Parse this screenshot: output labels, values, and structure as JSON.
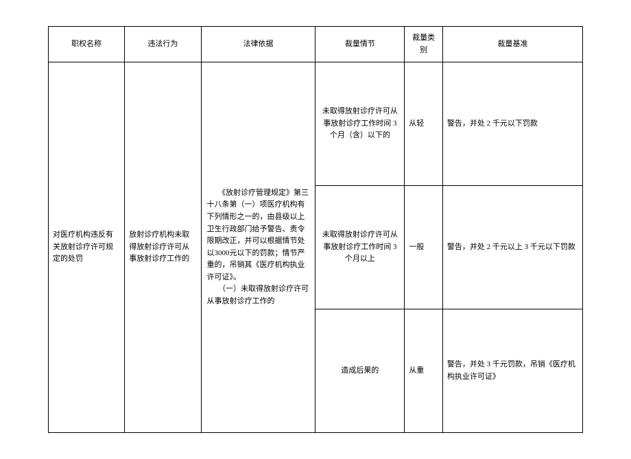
{
  "headers": {
    "authority": "职权名称",
    "violation": "违法行为",
    "legal_basis": "法律依据",
    "circumstance": "裁量情节",
    "category": "裁量类别",
    "standard": "裁量基准"
  },
  "content": {
    "authority_name": "对医疗机构违反有关放射诊疗许可规定的处罚",
    "violation_act": "放射诊疗机构未取得放射诊疗许可从事放射诊疗工作的",
    "legal_basis_text": "　　《放射诊疗管理规定》第三十八条第（一）项医疗机构有下列情形之一的，由县级以上卫生行政部门给予警告、责令限期改正，并可以根据情节处以3000元以下的罚款；情节严重的，吊销其《医疗机构执业许可证》。\n　　（一）未取得放射诊疗许可从事放射诊疗工作的",
    "rows": [
      {
        "circumstance": "未取得放射诊疗许可从事放射诊疗工作时间 3 个月（含）以下的",
        "category": "从轻",
        "standard": "警告，并处 2 千元以下罚款"
      },
      {
        "circumstance": "未取得放射诊疗许可从事放射诊疗工作时间 3 个月以上",
        "category": "一般",
        "standard": "警告，并处 2 千元以上 3 千元以下罚款"
      },
      {
        "circumstance": "造成后果的",
        "category": "从重",
        "standard": "警告，并处 3 千元罚款，吊销《医疗机构执业许可证》"
      }
    ]
  }
}
